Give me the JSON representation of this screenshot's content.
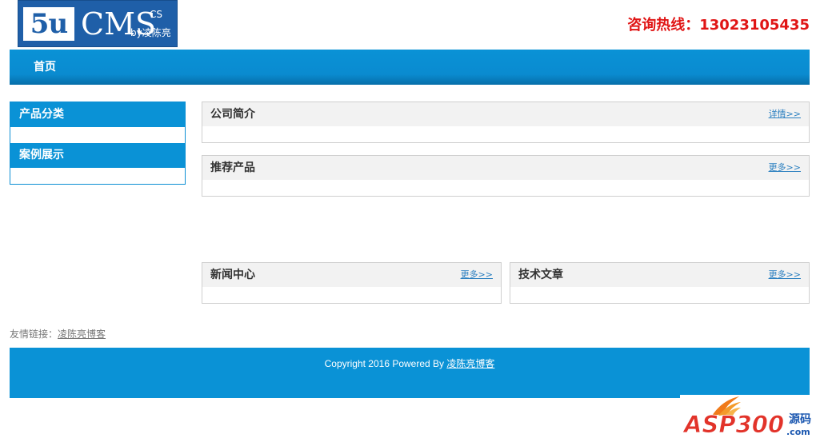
{
  "logo": {
    "five": "5u",
    "cms": "CMS",
    "cs": "CS",
    "by": "by凌陈亮"
  },
  "hotline": "咨询热线：13023105435",
  "nav": {
    "items": [
      {
        "label": "首页"
      }
    ]
  },
  "sidebar": {
    "items": [
      {
        "label": "产品分类"
      },
      {
        "label": "案例展示"
      }
    ]
  },
  "panels": {
    "about": {
      "title": "公司简介",
      "more": "详情>>"
    },
    "products": {
      "title": "推荐产品",
      "more": "更多>>"
    },
    "news": {
      "title": "新闻中心",
      "more": "更多>>"
    },
    "tech": {
      "title": "技术文章",
      "more": "更多>>"
    }
  },
  "friend_links": {
    "label": "友情链接：",
    "items": [
      {
        "text": "凌陈亮博客"
      }
    ]
  },
  "footer": {
    "copyright": "Copyright 2016 Powered By ",
    "link": "凌陈亮博客"
  },
  "watermark": {
    "brand": "ASP300",
    "suffix": "源码",
    "domain": ".com"
  },
  "colors": {
    "primary": "#0a92d6",
    "hotline": "#e01515",
    "logo_bg": "#1f5fa8"
  }
}
